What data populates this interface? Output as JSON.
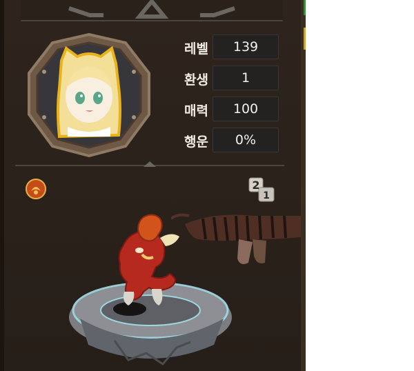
{
  "stats": [
    {
      "label": "레벨",
      "value": "139"
    },
    {
      "label": "환생",
      "value": "1"
    },
    {
      "label": "매력",
      "value": "100"
    },
    {
      "label": "행운",
      "value": "0%"
    }
  ],
  "portrait": {
    "icon": "character-portrait-icon"
  },
  "badge": {
    "icon": "guild-emblem-icon"
  },
  "rank": {
    "primary": "2",
    "secondary": "1"
  },
  "colors": {
    "panel": "#2a211b",
    "statBox": "#232221",
    "text": "#f0ebe4",
    "accent": "#e8b31a"
  }
}
